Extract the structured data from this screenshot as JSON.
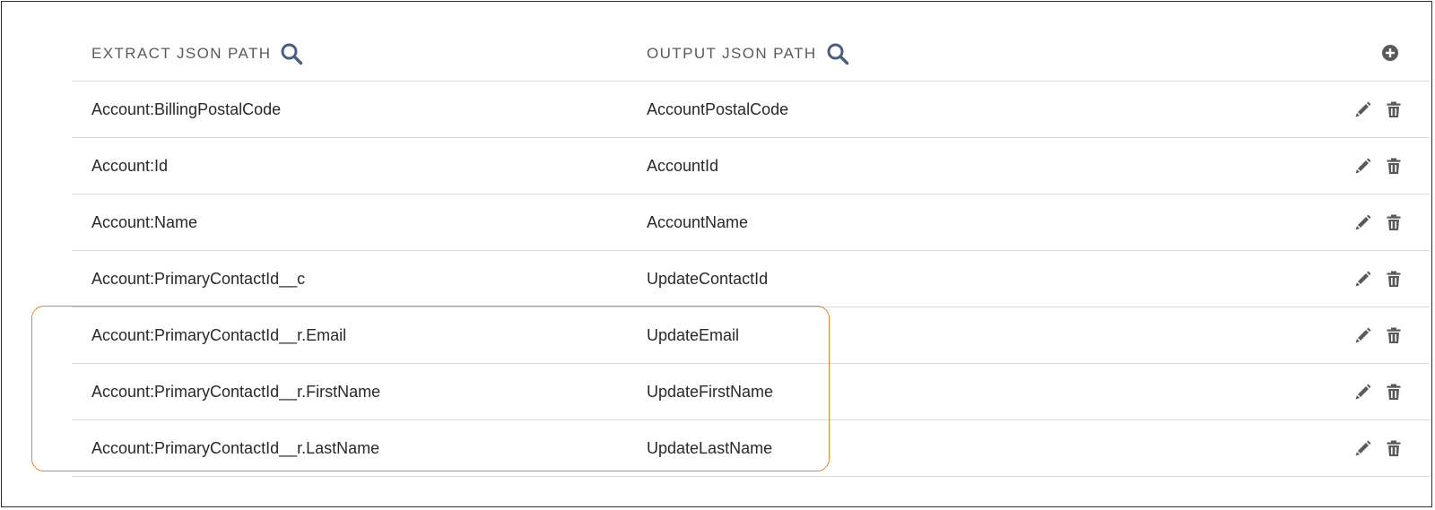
{
  "header": {
    "extract_label": "EXTRACT JSON PATH",
    "output_label": "OUTPUT JSON PATH"
  },
  "icons": {
    "search": "search-icon",
    "add": "add-circle-icon",
    "edit": "pencil-icon",
    "delete": "trash-icon"
  },
  "colors": {
    "icon": "#4a5e82",
    "action_icon": "#5c5a58",
    "divider": "#dddbda",
    "highlight": "#e8802f"
  },
  "rows": [
    {
      "extract": "Account:BillingPostalCode",
      "output": "AccountPostalCode"
    },
    {
      "extract": "Account:Id",
      "output": "AccountId"
    },
    {
      "extract": "Account:Name",
      "output": "AccountName"
    },
    {
      "extract": "Account:PrimaryContactId__c",
      "output": "UpdateContactId"
    },
    {
      "extract": "Account:PrimaryContactId__r.Email",
      "output": "UpdateEmail"
    },
    {
      "extract": "Account:PrimaryContactId__r.FirstName",
      "output": "UpdateFirstName"
    },
    {
      "extract": "Account:PrimaryContactId__r.LastName",
      "output": "UpdateLastName"
    }
  ]
}
